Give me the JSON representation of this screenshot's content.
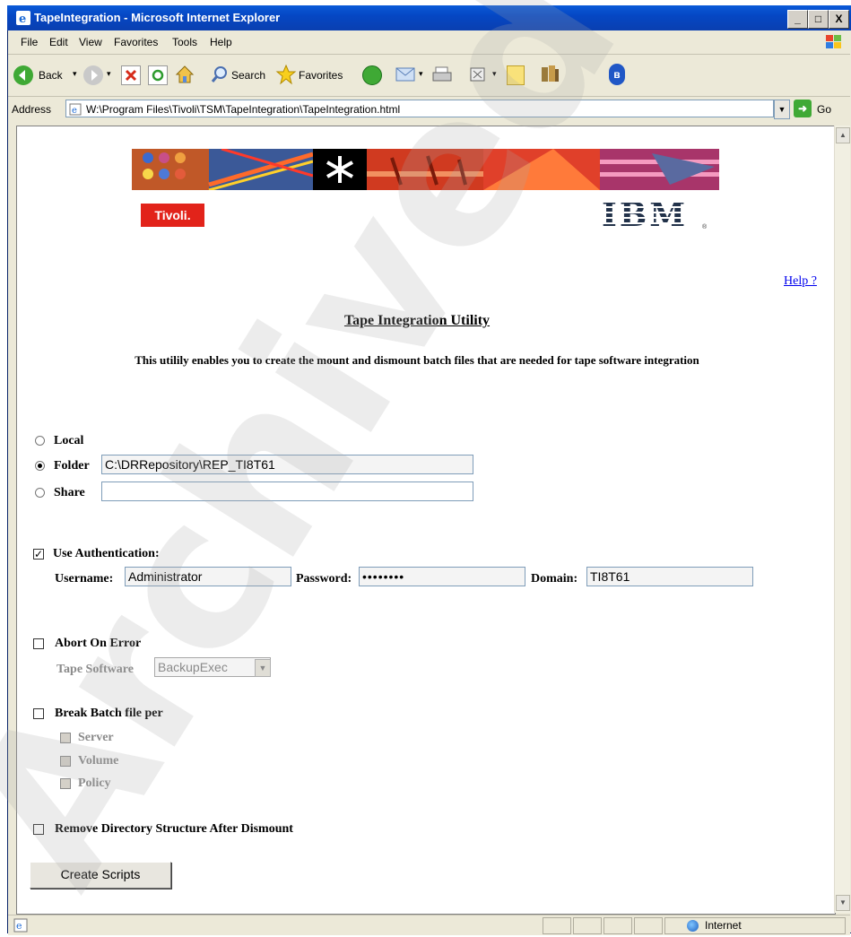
{
  "window": {
    "title": "TapeIntegration - Microsoft Internet Explorer",
    "minimize": "_",
    "restore": "□",
    "close": "X"
  },
  "menu": [
    "File",
    "Edit",
    "View",
    "Favorites",
    "Tools",
    "Help"
  ],
  "toolbar": {
    "back_label": "Back",
    "search_label": "Search",
    "favorites_label": "Favorites"
  },
  "address": {
    "label": "Address",
    "url": "W:\\Program Files\\Tivoli\\TSM\\TapeIntegration\\TapeIntegration.html",
    "go_label": "Go"
  },
  "banner": {
    "tivoli_logo": "Tivoli.",
    "ibm_logo": "IBM"
  },
  "page": {
    "help_link": "Help ?",
    "title": "Tape Integration Utility",
    "description": "This utilily enables you to create the mount and dismount batch files that are needed for tape software integration"
  },
  "location": {
    "local_label": "Local",
    "folder_label": "Folder",
    "folder_value": "C:\\DRRepository\\REP_TI8T61",
    "share_label": "Share",
    "share_value": "",
    "selected": "Folder"
  },
  "auth": {
    "use_label": "Use Authentication:",
    "checked": true,
    "username_label": "Username:",
    "username_value": "Administrator",
    "password_label": "Password:",
    "password_value": "••••••••",
    "domain_label": "Domain:",
    "domain_value": "TI8T61"
  },
  "abort": {
    "label": "Abort On Error",
    "checked": false,
    "tape_software_label": "Tape Software",
    "tape_software_value": "BackupExec"
  },
  "break_batch": {
    "label": "Break Batch file per",
    "checked": false,
    "options": [
      "Server",
      "Volume",
      "Policy"
    ]
  },
  "remove_dir": {
    "label": "Remove Directory Structure After Dismount",
    "checked": false
  },
  "create_button": "Create Scripts",
  "status": {
    "zone": "Internet"
  },
  "watermark": "Archived",
  "colors": {
    "title_bar": "#0a50d0",
    "chrome": "#ece9d8",
    "tivoli_red": "#e2231a",
    "link": "#0000ee"
  }
}
